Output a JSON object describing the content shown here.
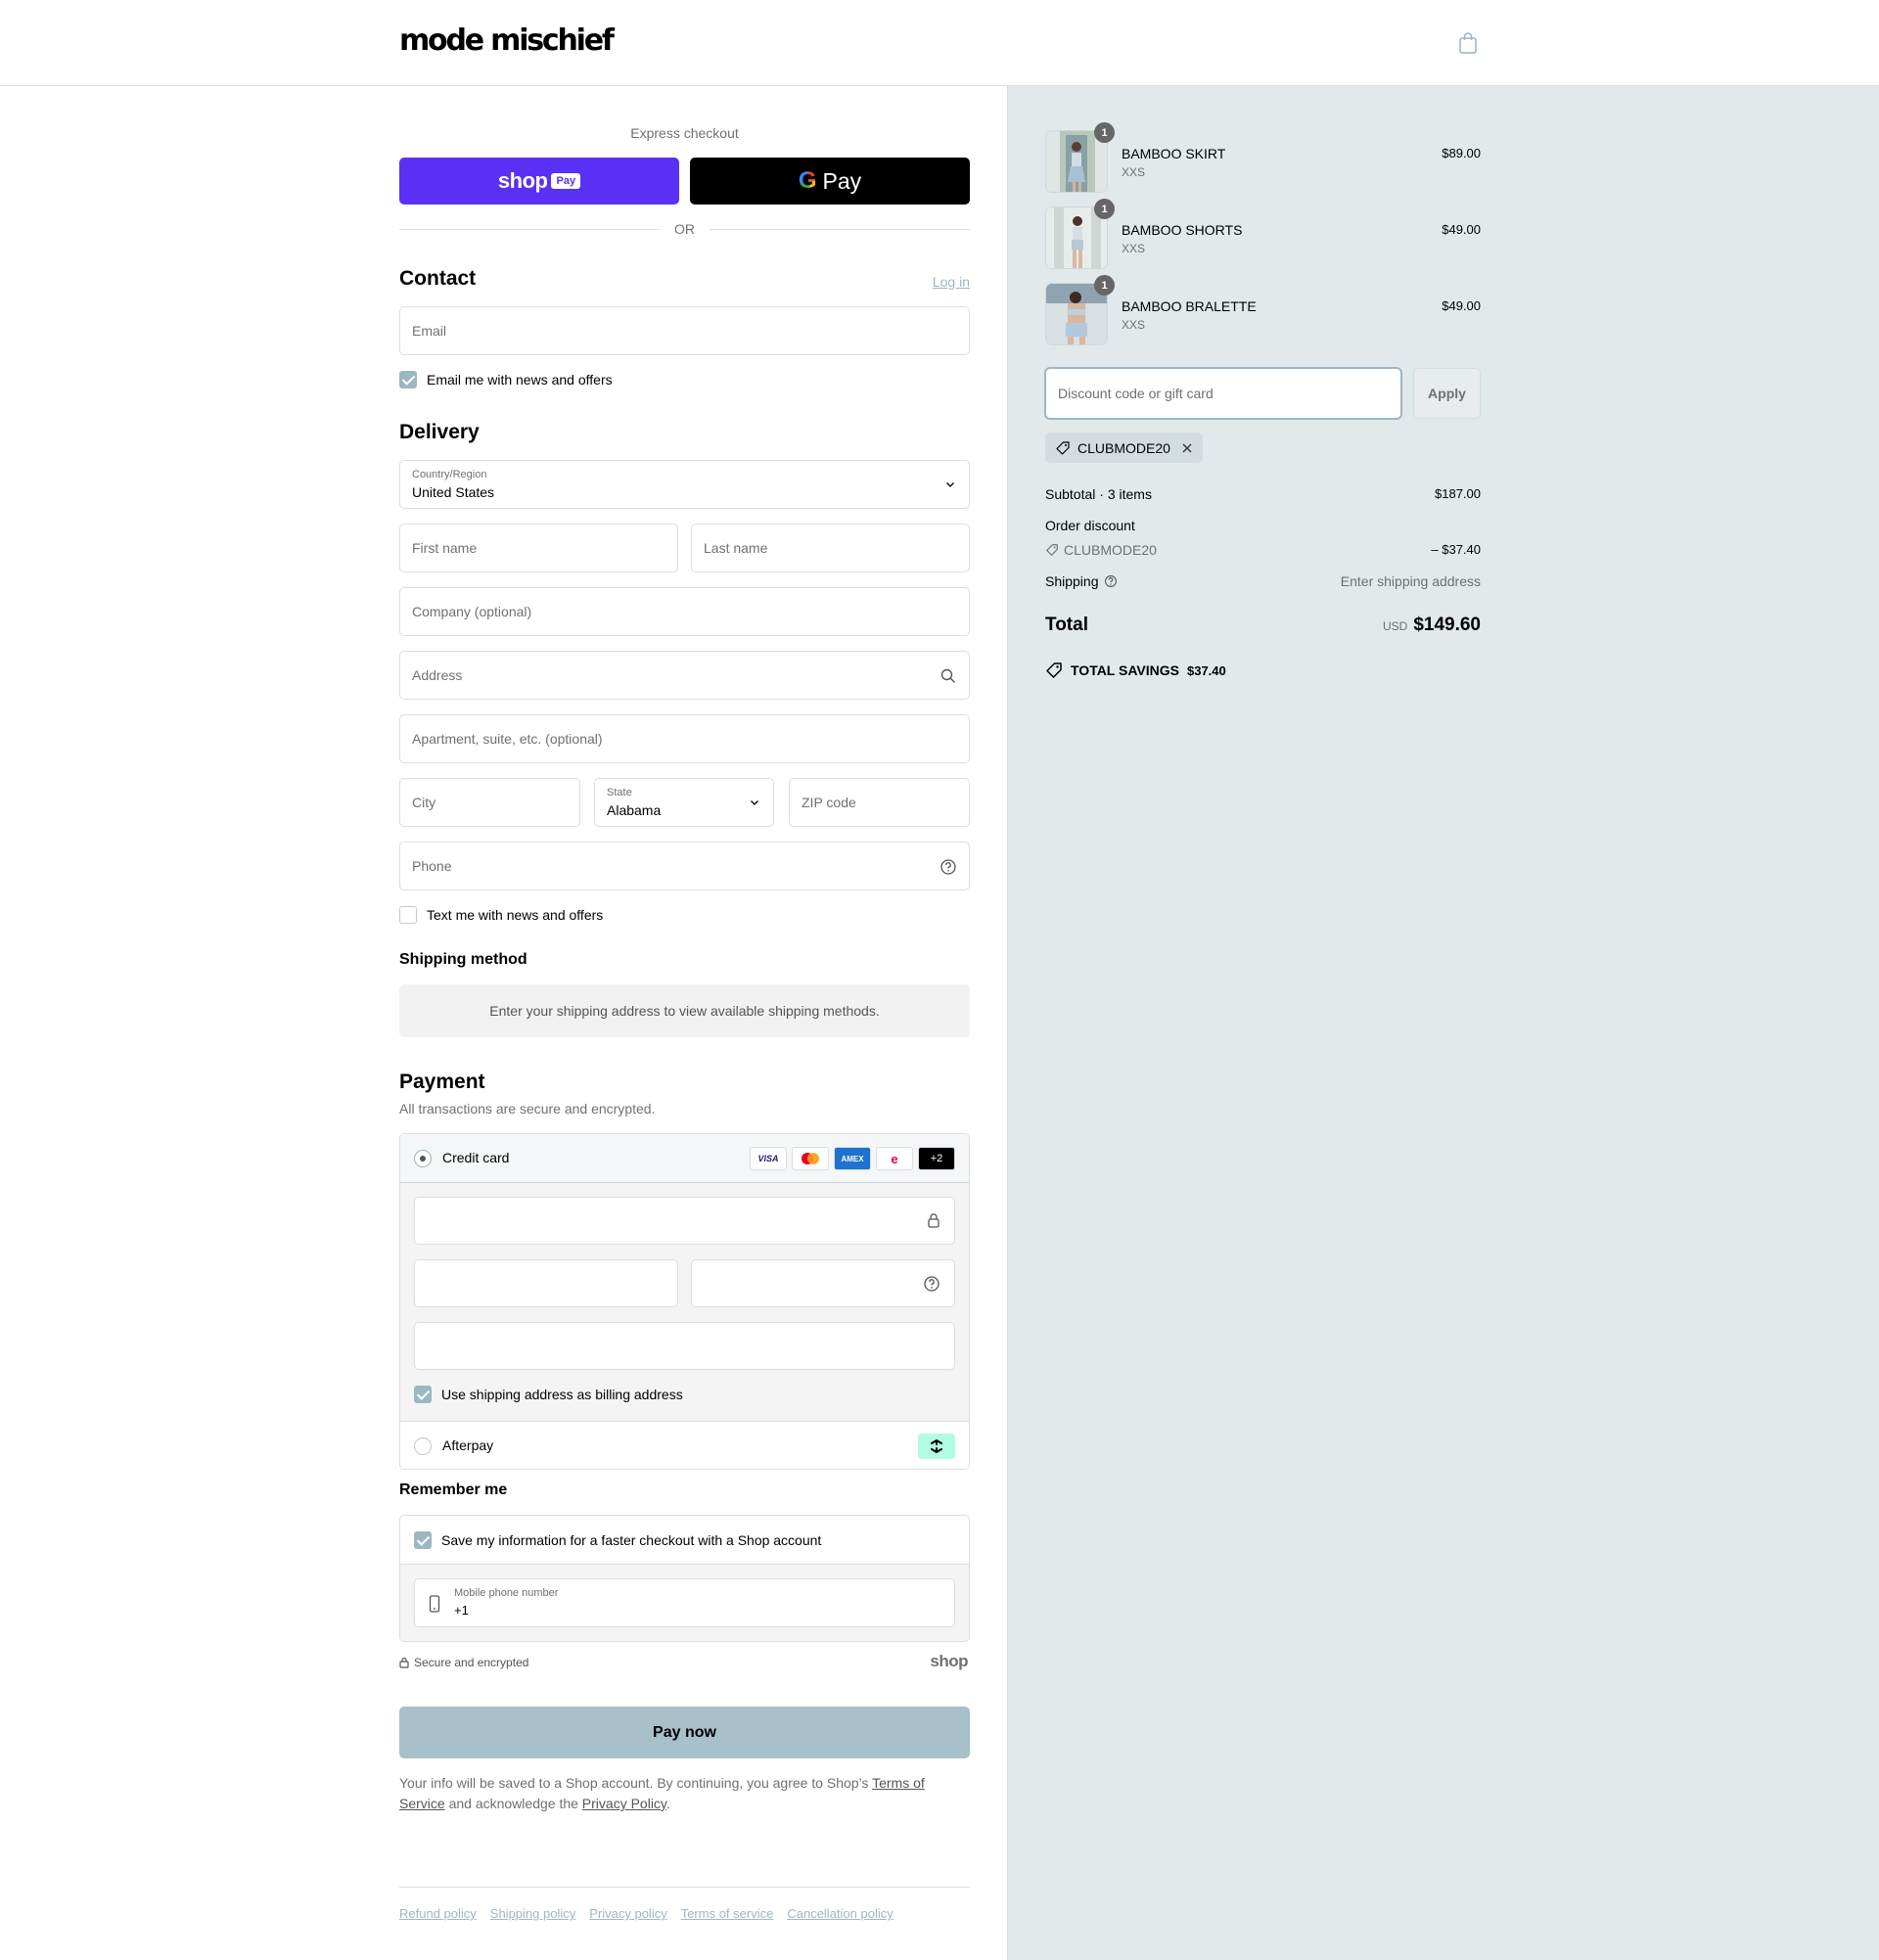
{
  "brand": {
    "name": "mode mischief"
  },
  "colors": {
    "accent": "#9db7c2",
    "shop_purple": "#5a31f4",
    "summary_bg": "#e1e9eb"
  },
  "express": {
    "label": "Express checkout",
    "shop_word": "shop",
    "shop_pay": "Pay",
    "gpay_g": "G",
    "gpay_pay": "Pay",
    "or": "OR"
  },
  "contact": {
    "title": "Contact",
    "login": "Log in",
    "email_placeholder": "Email",
    "newsletter": "Email me with news and offers",
    "newsletter_checked": true
  },
  "delivery": {
    "title": "Delivery",
    "country_label": "Country/Region",
    "country_value": "United States",
    "first_name": "First name",
    "last_name": "Last name",
    "company": "Company (optional)",
    "address": "Address",
    "apartment": "Apartment, suite, etc. (optional)",
    "city": "City",
    "state_label": "State",
    "state_value": "Alabama",
    "zip": "ZIP code",
    "phone": "Phone",
    "sms": "Text me with news and offers",
    "sms_checked": false
  },
  "shipping_method": {
    "title": "Shipping method",
    "message": "Enter your shipping address to view available shipping methods."
  },
  "payment": {
    "title": "Payment",
    "subtitle": "All transactions are secure and encrypted.",
    "credit_card": "Credit card",
    "selected": "Credit card",
    "cards": [
      "VISA",
      "mastercard",
      "AMEX",
      "elo",
      "+2"
    ],
    "billing_same": "Use shipping address as billing address",
    "billing_checked": true,
    "afterpay": "Afterpay"
  },
  "remember": {
    "title": "Remember me",
    "save": "Save my information for a faster checkout with a Shop account",
    "save_checked": true,
    "mobile_label": "Mobile phone number",
    "mobile_value": "+1"
  },
  "secure": {
    "text": "Secure and encrypted",
    "shop_mark": "shop"
  },
  "pay_now": "Pay now",
  "legal": {
    "pre": "Your info will be saved to a Shop account. By continuing, you agree to Shop’s ",
    "tos": "Terms of Service",
    "mid": " and acknowledge the ",
    "privacy": "Privacy Policy",
    "end": "."
  },
  "footer": {
    "links": [
      "Refund policy",
      "Shipping policy",
      "Privacy policy",
      "Terms of service",
      "Cancellation policy"
    ]
  },
  "summary": {
    "items": [
      {
        "name": "BAMBOO SKIRT",
        "variant": "XXS",
        "price": "$89.00",
        "qty": "1"
      },
      {
        "name": "BAMBOO SHORTS",
        "variant": "XXS",
        "price": "$49.00",
        "qty": "1"
      },
      {
        "name": "BAMBOO BRALETTE",
        "variant": "XXS",
        "price": "$49.00",
        "qty": "1"
      }
    ],
    "discount_placeholder": "Discount code or gift card",
    "apply": "Apply",
    "code_chip": "CLUBMODE20",
    "subtotal_label": "Subtotal · 3 items",
    "subtotal_value": "$187.00",
    "order_discount_label": "Order discount",
    "discount_code": "CLUBMODE20",
    "discount_value": "– $37.40",
    "shipping_label": "Shipping",
    "shipping_value": "Enter shipping address",
    "total_label": "Total",
    "currency": "USD",
    "total_value": "$149.60",
    "savings_label": "TOTAL SAVINGS",
    "savings_value": "$37.40"
  }
}
